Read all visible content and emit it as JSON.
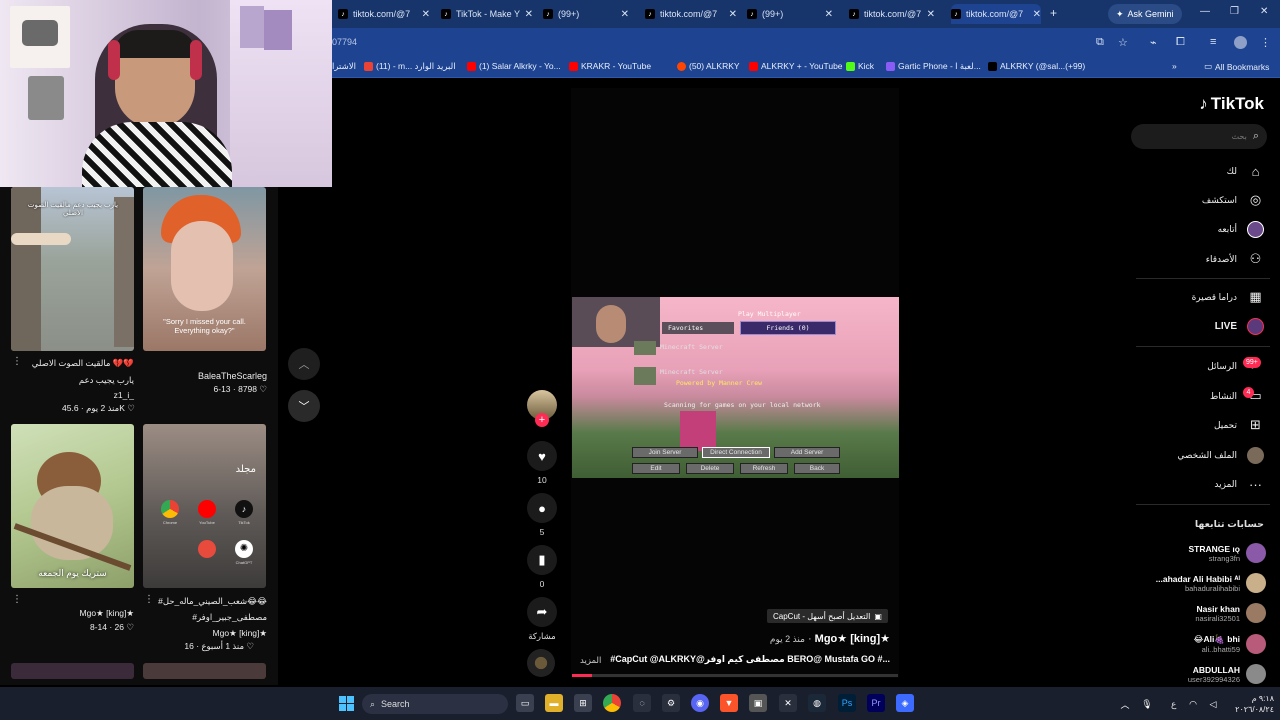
{
  "browser": {
    "tabs": [
      {
        "title": "tiktok.com/@7"
      },
      {
        "title": "TikTok - Make Y"
      },
      {
        "title": "(99+)"
      },
      {
        "title": "tiktok.com/@7"
      },
      {
        "title": "(99+)"
      },
      {
        "title": "tiktok.com/@7"
      },
      {
        "title": "tiktok.com/@7"
      }
    ],
    "new_tab": "+",
    "gemini_label": "Ask Gemini",
    "url": "07794",
    "bookmarks": [
      {
        "label": "الاشترا"
      },
      {
        "label": "(11) - m... البريد الوارد"
      },
      {
        "label": "(1) Salar Alkrky - Yo..."
      },
      {
        "label": "KRAKR - YouTube"
      },
      {
        "label": "(50) ALKRKY"
      },
      {
        "label": "ALKRKY + - YouTube"
      },
      {
        "label": "Kick"
      },
      {
        "label": "Gartic Phone - لعبة ا..."
      },
      {
        "label": "ALKRKY (@sal...(+99)"
      }
    ],
    "all_bookmarks": "All Bookmarks"
  },
  "feed": {
    "items": [
      {
        "overlay": "يارب يجيب دعم مالقيت الصوت الاصلي",
        "desc_line1": "مالقيت الصوت الاصلي 💔💔",
        "desc_line2": "يارب يجيب دعم",
        "author": "z1_i_",
        "meta": "منذ 2 يوم",
        "likes": "45.6K"
      },
      {
        "overlay": "\"Sorry I missed your call. Everything okay?\"",
        "author": "BaleaTheScarleg",
        "meta": "6-13",
        "likes": "8798"
      },
      {
        "overlay": "ستريك يوم الجمعه",
        "author": "Mgo★ [king]★",
        "meta": "8-14",
        "likes": "26"
      },
      {
        "overlay": "مجلد",
        "desc_line1": "#شعب_الصيني_ماله_حل😂😂",
        "desc_line2": "#مصطفى_جبير_اوفر",
        "author": "Mgo★ [king]★",
        "meta": "منذ 1 أسبوع",
        "likes": "16"
      }
    ],
    "app_labels": [
      "Chrome",
      "YouTube",
      "TikTok",
      "ChatGPT"
    ]
  },
  "video": {
    "game": {
      "title": "Play Multiplayer",
      "favorites": "Favorites",
      "friends": "Friends (0)",
      "server1": "Minecraft Server",
      "server2": "Minecraft Server",
      "powered": "Powered by Manner Crew",
      "scanning": "Scanning for games on your local network",
      "buttons": [
        "Join Server",
        "Direct Connection",
        "Add Server",
        "Edit",
        "Delete",
        "Refresh",
        "Back"
      ]
    },
    "actions": {
      "likes": "10",
      "comments": "5",
      "saves": "0",
      "share": "مشاركة"
    },
    "capcut": "CapCut - التعديل أصبح أسهل",
    "author": "Mgo★ [king]★",
    "time": "منذ 2 يوم",
    "caption": "#CapCut @ALKRKY@مصطفى كيم اوفر BERO@ Mustafa GO #...",
    "more": "المزيد"
  },
  "sidebar": {
    "logo": "TikTok",
    "search_placeholder": "بحث",
    "nav": [
      "لك",
      "استكشف",
      "أتابعه",
      "الأصدقاء",
      "دراما قصيرة",
      "LIVE",
      "الرسائل",
      "النشاط",
      "تحميل",
      "الملف الشخصي",
      "المزيد"
    ],
    "messages_badge": "99+",
    "activity_badge": "4",
    "following_title": "حسابات تتابعها",
    "accounts": [
      {
        "name": "STRANGE ıǫ",
        "handle": "strang3fn"
      },
      {
        "name": "...ahadar Ali Habibi ᴬᴵ",
        "handle": "bahaduralihabibi"
      },
      {
        "name": "Nasir khan",
        "handle": "nasirali32501"
      },
      {
        "name": "😂Ali🍇 bhi",
        "handle": "ali..bhatti59"
      },
      {
        "name": "ABDULLAH",
        "handle": "user392994326"
      }
    ]
  },
  "taskbar": {
    "search": "Search",
    "time": "٩:١٨ م",
    "date": "٢٠٢٦/٠٨/٢٤",
    "lang": "ع"
  },
  "colors": {
    "accent": "#fe2c55",
    "browser": "#1d4391",
    "tabbar": "#17356b"
  }
}
